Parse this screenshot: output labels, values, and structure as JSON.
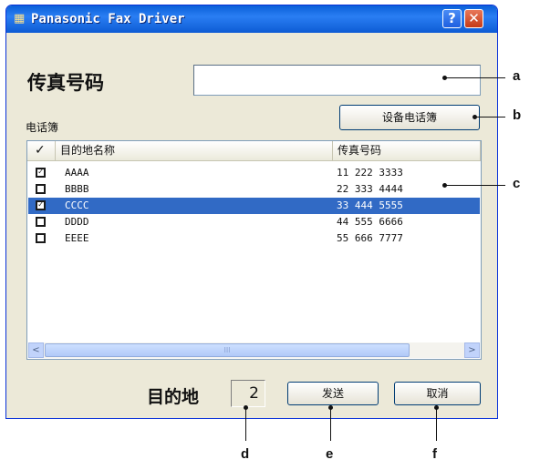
{
  "window": {
    "title": "Panasonic Fax Driver",
    "help_label": "?",
    "close_label": "✕"
  },
  "fax_number": {
    "label": "传真号码",
    "value": ""
  },
  "phonebook": {
    "label": "电话簿",
    "device_button": "设备电话簿",
    "columns": {
      "check": "✓",
      "name": "目的地名称",
      "fax": "传真号码"
    },
    "rows": [
      {
        "name": "AAAA",
        "fax": "11 222 3333",
        "checked": true,
        "selected": false
      },
      {
        "name": "BBBB",
        "fax": "22 333 4444",
        "checked": false,
        "selected": false
      },
      {
        "name": "CCCC",
        "fax": "33 444 5555",
        "checked": true,
        "selected": true
      },
      {
        "name": "DDDD",
        "fax": "44 555 6666",
        "checked": false,
        "selected": false
      },
      {
        "name": "EEEE",
        "fax": "55 666 7777",
        "checked": false,
        "selected": false
      }
    ],
    "scroll_left": "<",
    "scroll_right": ">",
    "scroll_thumb": "III"
  },
  "destination": {
    "label": "目的地",
    "count": "2"
  },
  "buttons": {
    "send": "发送",
    "cancel": "取消"
  },
  "callouts": {
    "a": "a",
    "b": "b",
    "c": "c",
    "d": "d",
    "e": "e",
    "f": "f"
  }
}
